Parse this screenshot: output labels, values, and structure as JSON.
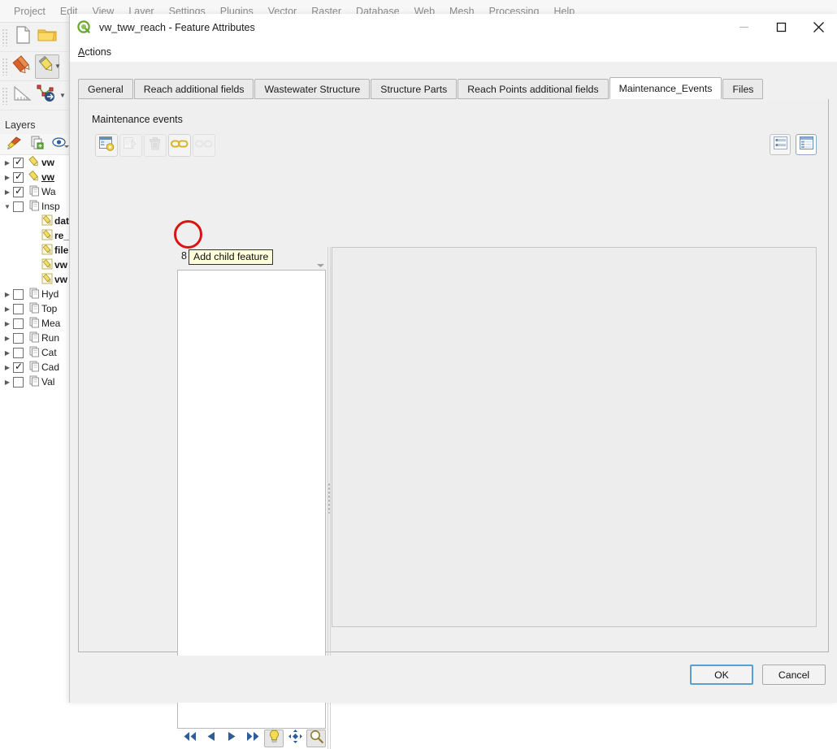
{
  "qgis": {
    "menubar": [
      "Project",
      "Edit",
      "View",
      "Layer",
      "Settings",
      "Plugins",
      "Vector",
      "Raster",
      "Database",
      "Web",
      "Mesh",
      "Processing",
      "Help"
    ],
    "toolbar_icons": [
      "new-file-icon",
      "open-folder-icon",
      "pencil-red-icon",
      "pencil-yellow-icon",
      "measure-icon",
      "vertex-tool-icon"
    ],
    "layers_panel": {
      "title": "Layers",
      "toolbar_icons": [
        "styling-brush-icon",
        "add-group-icon",
        "visibility-eye-icon"
      ],
      "items": [
        {
          "label": "vw",
          "checked": true,
          "expandable": true,
          "icon": "line-layer-icon",
          "bold": true,
          "underline": false,
          "indent": 0
        },
        {
          "label": "vw",
          "checked": true,
          "expandable": true,
          "icon": "line-layer-icon",
          "bold": true,
          "underline": true,
          "indent": 0
        },
        {
          "label": "Wa",
          "checked": true,
          "expandable": true,
          "icon": "table-layer-icon",
          "bold": false,
          "underline": false,
          "indent": 0
        },
        {
          "label": "Insp",
          "checked": false,
          "expandable": true,
          "expanded": true,
          "icon": "table-layer-icon",
          "bold": false,
          "underline": false,
          "indent": 0
        },
        {
          "label": "dat",
          "checked": null,
          "expandable": false,
          "icon": "edit-layer-icon",
          "bold": true,
          "underline": false,
          "indent": 1
        },
        {
          "label": "re_",
          "checked": null,
          "expandable": false,
          "icon": "edit-layer-icon",
          "bold": true,
          "underline": false,
          "indent": 1
        },
        {
          "label": "file",
          "checked": null,
          "expandable": false,
          "icon": "edit-layer-icon",
          "bold": true,
          "underline": false,
          "indent": 1
        },
        {
          "label": "vw",
          "checked": null,
          "expandable": false,
          "icon": "edit-layer-icon",
          "bold": true,
          "underline": false,
          "indent": 1
        },
        {
          "label": "vw",
          "checked": null,
          "expandable": false,
          "icon": "edit-layer-icon",
          "bold": true,
          "underline": false,
          "indent": 1
        },
        {
          "label": "Hyd",
          "checked": false,
          "expandable": true,
          "icon": "table-layer-icon",
          "bold": false,
          "underline": false,
          "indent": 0
        },
        {
          "label": "Top",
          "checked": false,
          "expandable": true,
          "icon": "table-layer-icon",
          "bold": false,
          "underline": false,
          "indent": 0
        },
        {
          "label": "Mea",
          "checked": false,
          "expandable": true,
          "icon": "table-layer-icon",
          "bold": false,
          "underline": false,
          "indent": 0
        },
        {
          "label": "Run",
          "checked": false,
          "expandable": true,
          "icon": "table-layer-icon",
          "bold": false,
          "underline": false,
          "indent": 0
        },
        {
          "label": "Cat",
          "checked": false,
          "expandable": true,
          "icon": "table-layer-icon",
          "bold": false,
          "underline": false,
          "indent": 0
        },
        {
          "label": "Cad",
          "checked": true,
          "expandable": true,
          "icon": "table-layer-icon",
          "bold": false,
          "underline": false,
          "indent": 0
        },
        {
          "label": "Val",
          "checked": false,
          "expandable": true,
          "icon": "table-layer-icon",
          "bold": false,
          "underline": false,
          "indent": 0
        }
      ]
    }
  },
  "dialog": {
    "title": "vw_tww_reach - Feature Attributes",
    "app_icon": "qgis-logo-icon",
    "window_buttons": {
      "minimize": "minimize-icon",
      "maximize": "maximize-icon",
      "close": "close-icon"
    },
    "menubar": {
      "actions": "Actions"
    },
    "tabs": [
      {
        "label": "General",
        "selected": false
      },
      {
        "label": "Reach additional fields",
        "selected": false
      },
      {
        "label": "Wastewater Structure",
        "selected": false
      },
      {
        "label": "Structure Parts",
        "selected": false
      },
      {
        "label": "Reach Points additional fields",
        "selected": false
      },
      {
        "label": "Maintenance_Events",
        "selected": true
      },
      {
        "label": "Files",
        "selected": false
      }
    ],
    "group_label": "Maintenance events",
    "relation_toolbar": {
      "buttons": [
        {
          "name": "add-child-feature-button",
          "icon": "add-child-feature-icon",
          "enabled": true,
          "highlighted": true
        },
        {
          "name": "duplicate-child-feature-button",
          "icon": "duplicate-feature-icon",
          "enabled": false,
          "highlighted": false
        },
        {
          "name": "delete-child-feature-button",
          "icon": "trash-icon",
          "enabled": false,
          "highlighted": false
        },
        {
          "name": "link-feature-button",
          "icon": "link-chain-icon",
          "enabled": true,
          "highlighted": false
        },
        {
          "name": "unlink-feature-button",
          "icon": "unlink-chain-icon",
          "enabled": false,
          "highlighted": false
        }
      ],
      "view_buttons": [
        {
          "name": "form-view-button",
          "icon": "form-view-icon",
          "active": false
        },
        {
          "name": "table-view-button",
          "icon": "table-view-icon",
          "active": true
        }
      ]
    },
    "tooltip": {
      "text": "Add child feature",
      "visible": true
    },
    "obscured_text": "8",
    "feature_nav": [
      {
        "name": "first-feature-button",
        "icon": "first-icon"
      },
      {
        "name": "previous-feature-button",
        "icon": "previous-icon"
      },
      {
        "name": "next-feature-button",
        "icon": "next-icon"
      },
      {
        "name": "last-feature-button",
        "icon": "last-icon"
      },
      {
        "name": "highlight-feature-button",
        "icon": "lightbulb-icon",
        "pressed": true
      },
      {
        "name": "pan-to-feature-button",
        "icon": "pan-icon",
        "pressed": false
      },
      {
        "name": "zoom-to-feature-button",
        "icon": "magnifier-icon",
        "pressed": true
      }
    ],
    "footer": {
      "ok_label": "OK",
      "cancel_label": "Cancel"
    }
  },
  "colors": {
    "annotation": "#d81414",
    "tooltip_bg": "#ffffdc",
    "dialog_bg": "#f0f0f0",
    "panel_bg": "#efefef",
    "accent_default_button": "#5a9fd4"
  }
}
